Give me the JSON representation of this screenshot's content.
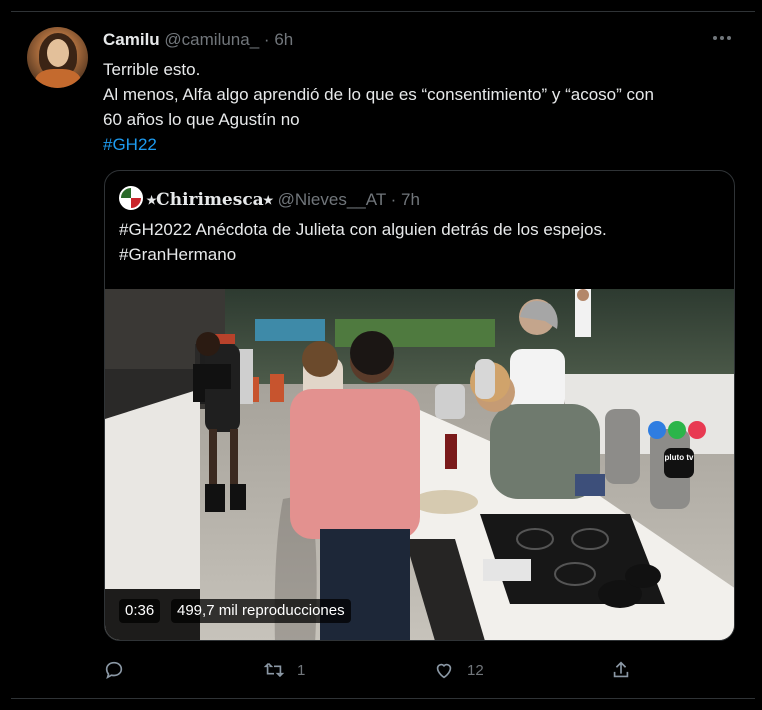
{
  "tweet": {
    "author_name": "Camilu",
    "author_handle": "@camiluna_",
    "separator": "·",
    "time": "6h",
    "more_icon": "more-horizontal-icon",
    "line1": "Terrible esto.",
    "line2": "Al menos, Alfa algo aprendió de lo que es “consentimiento” y “acoso” con",
    "line3": "60 años lo que Agustín no",
    "hashtag": "#GH22"
  },
  "quote": {
    "author_name": "⭑Chirimesca⭑",
    "author_handle": "@Nieves__AT",
    "separator": "·",
    "time": "7h",
    "line1": "#GH2022 Anécdota de Julieta con alguien detrás de los espejos.",
    "line2": "#GranHermano",
    "video": {
      "duration": "0:36",
      "views": "499,7 mil reproducciones",
      "channel_badge": "pluto tv"
    }
  },
  "actions": {
    "reply_icon": "reply-icon",
    "retweet_icon": "retweet-icon",
    "retweet_count": "1",
    "like_icon": "heart-icon",
    "like_count": "12",
    "share_icon": "share-icon"
  },
  "colors": {
    "background": "#000000",
    "text": "#e7e9ea",
    "muted": "#71767b",
    "link": "#1d9bf0",
    "border": "#2f3336"
  }
}
